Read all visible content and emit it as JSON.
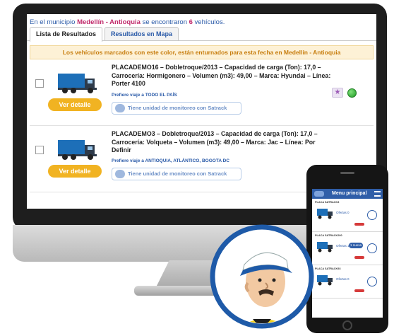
{
  "summary": {
    "prefix": "En el municipio ",
    "location": "Medellín - Antioquia",
    "middle": " se encontraron ",
    "count": "6",
    "suffix": " vehículos."
  },
  "tabs": [
    {
      "label": "Lista de Resultados",
      "active": true
    },
    {
      "label": "Resultados en Mapa",
      "active": false
    }
  ],
  "notice": "Los vehículos marcados con este color, están enturnados para esta fecha en Medellín - Antioquia",
  "results": [
    {
      "description": "PLACADEMO16 – Dobletroque/2013 – Capacidad de carga (Ton): 17,0 – Carrocería: Hormigonero – Volumen (m3): 49,00 – Marca: Hyundai – Línea: Porter 4100",
      "preference": "Prefiere viaje a TODO EL PAÍS",
      "satrack": "Tiene unidad de monitoreo con Satrack",
      "detail_label": "Ver detalle",
      "favorite_icon": "star-icon",
      "status_color": "#2aa52f"
    },
    {
      "description": "PLACADEMO3 – Dobletroque/2013 – Capacidad de carga (Ton): 17,0 – Carrocería: Volqueta – Volumen (m3): 49,00 – Marca: Jac – Línea: Por Definir",
      "preference": "Prefiere viaje a ANTIOQUIA, ATLÁNTICO, BOGOTA DC",
      "satrack": "Tiene unidad de monitoreo con Satrack",
      "detail_label": "Ver detalle"
    }
  ],
  "phone": {
    "header": "Menu principal",
    "cards": [
      {
        "title": "PLACA SATRACK3",
        "offer": "Ofertas 0"
      },
      {
        "title": "PLACA SATRACK200",
        "offer": "Ofertas 1",
        "badge": "1 nueva"
      },
      {
        "title": "PLACA SATRACK93",
        "offer": "Ofertas 0"
      }
    ]
  },
  "colors": {
    "accent_blue": "#2a5aa8",
    "highlight_magenta": "#c02a6b",
    "button_yellow": "#f1b322",
    "notice_bg": "#fdf1d6"
  }
}
